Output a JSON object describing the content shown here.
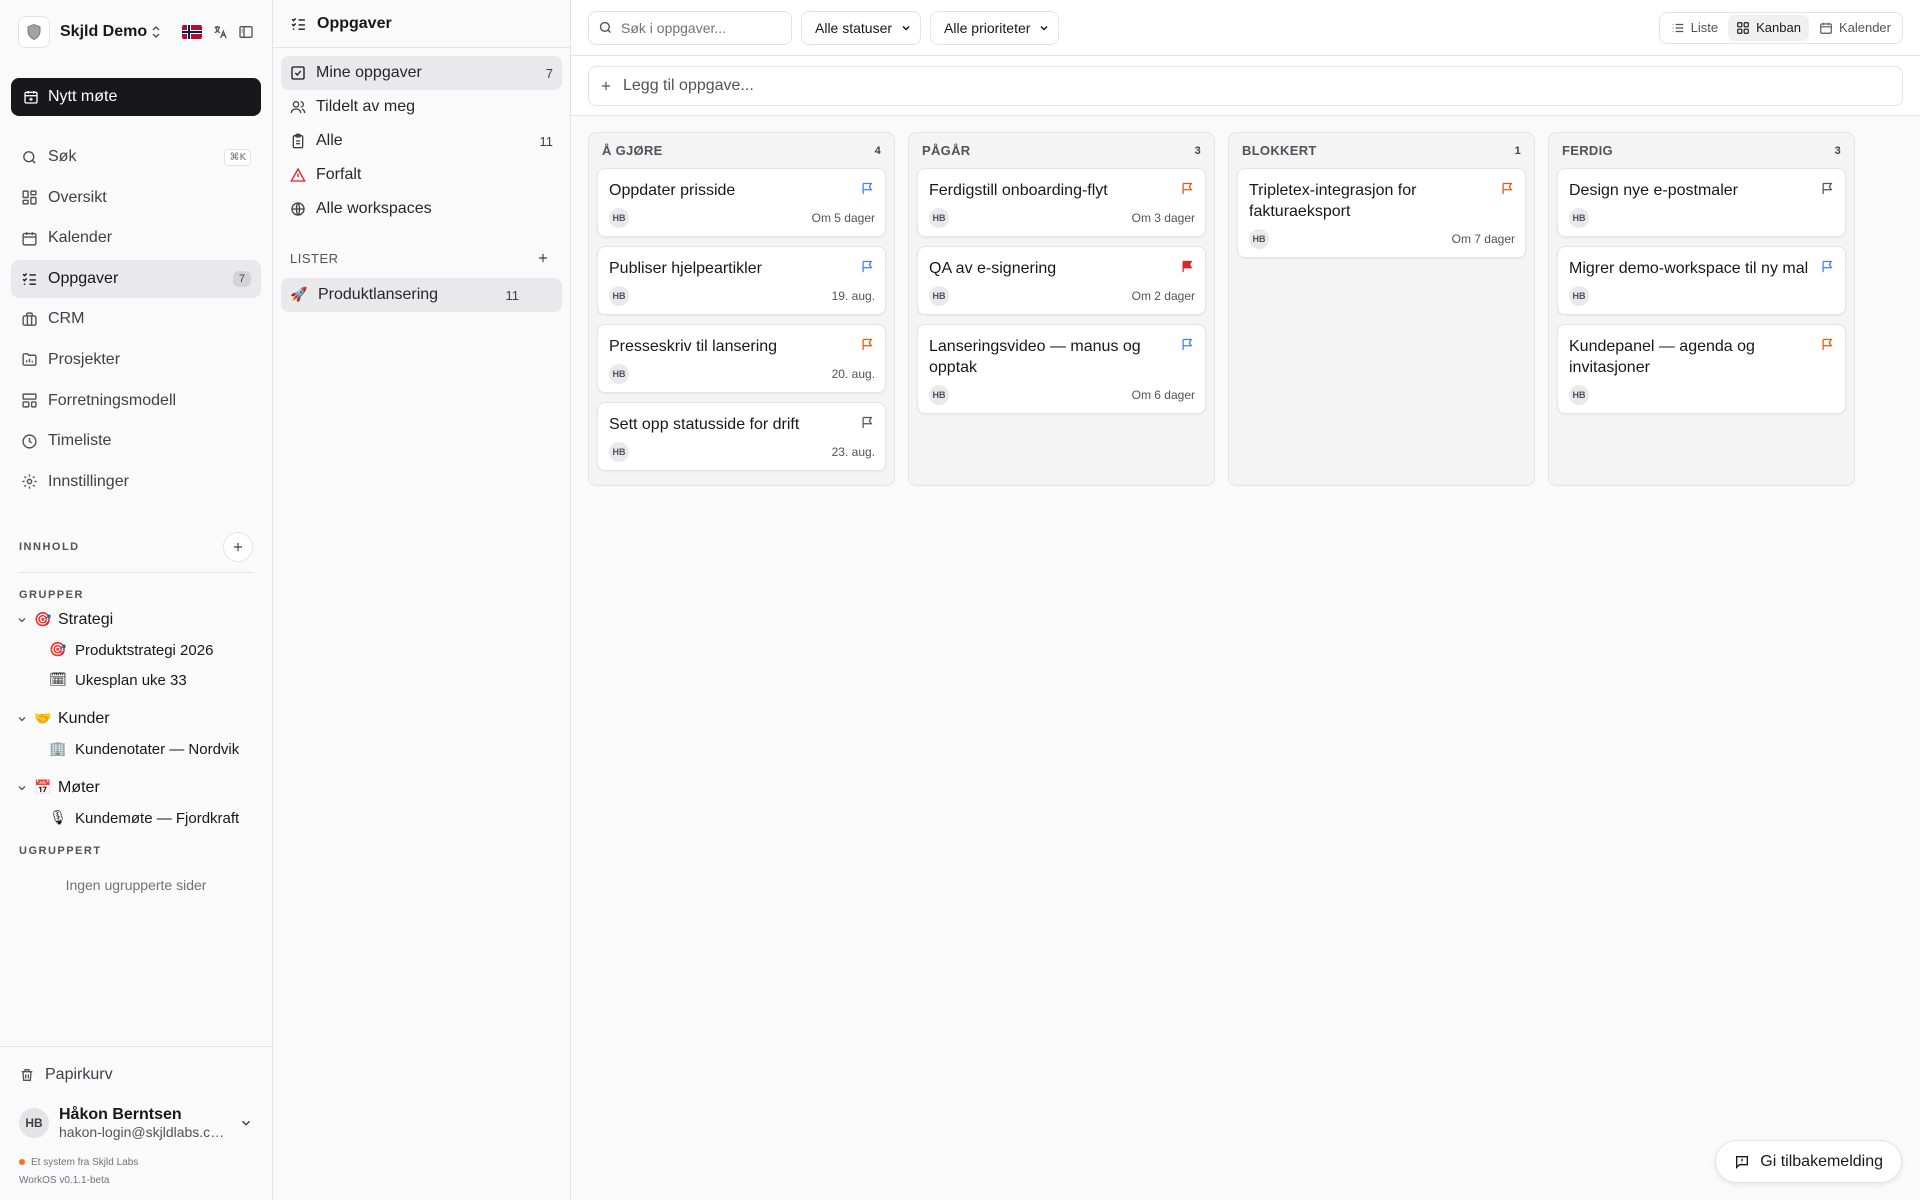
{
  "sidebar": {
    "workspace_name": "Skjld Demo",
    "new_meeting_label": "Nytt møte",
    "nav": [
      {
        "label": "Søk",
        "icon": "search-icon",
        "shortcut": "⌘K"
      },
      {
        "label": "Oversikt",
        "icon": "dashboard-icon"
      },
      {
        "label": "Kalender",
        "icon": "calendar-icon"
      },
      {
        "label": "Oppgaver",
        "icon": "tasks-icon",
        "badge": "7",
        "active": true
      },
      {
        "label": "CRM",
        "icon": "briefcase-icon"
      },
      {
        "label": "Prosjekter",
        "icon": "folder-chart-icon"
      },
      {
        "label": "Forretningsmodell",
        "icon": "layout-icon"
      },
      {
        "label": "Timeliste",
        "icon": "clock-icon"
      },
      {
        "label": "Innstillinger",
        "icon": "gear-icon"
      }
    ],
    "content_label": "INNHOLD",
    "groups_label": "GRUPPER",
    "groups": [
      {
        "emoji": "🎯",
        "label": "Strategi",
        "pages": [
          {
            "emoji": "🎯",
            "label": "Produktstrategi 2026"
          },
          {
            "emoji": "🗓",
            "label": "Ukesplan uke 33"
          }
        ]
      },
      {
        "emoji": "🤝",
        "label": "Kunder",
        "pages": [
          {
            "emoji": "🏢",
            "label": "Kundenotater — Nordvik"
          }
        ]
      },
      {
        "emoji": "📅",
        "label": "Møter",
        "pages": [
          {
            "emoji": "🎙",
            "label": "Kundemøte — Fjordkraft"
          }
        ]
      }
    ],
    "ungrouped_label": "UGRUPPERT",
    "ungrouped_empty": "Ingen ugrupperte sider",
    "trash_label": "Papirkurv",
    "user": {
      "initials": "HB",
      "name": "Håkon Berntsen",
      "email": "hakon-login@skjldlabs.com"
    },
    "credit": "Et system fra Skjld Labs",
    "version": "WorkOS v0.1.1-beta"
  },
  "panel": {
    "title": "Oppgaver",
    "items": [
      {
        "label": "Mine oppgaver",
        "count": "7",
        "icon": "checkbox-icon",
        "active": true
      },
      {
        "label": "Tildelt av meg",
        "count": "",
        "icon": "users-icon"
      },
      {
        "label": "Alle",
        "count": "11",
        "icon": "clipboard-icon"
      },
      {
        "label": "Forfalt",
        "count": "",
        "icon": "warning-icon"
      },
      {
        "label": "Alle workspaces",
        "count": "",
        "icon": "globe-icon"
      }
    ],
    "lists_label": "LISTER",
    "lists": [
      {
        "emoji": "🚀",
        "label": "Produktlansering",
        "count": "11"
      }
    ]
  },
  "toolbar": {
    "search_placeholder": "Søk i oppgaver...",
    "status_filter": "Alle statuser",
    "priority_filter": "Alle prioriteter",
    "views": [
      {
        "label": "Liste",
        "icon": "list-icon"
      },
      {
        "label": "Kanban",
        "icon": "kanban-icon",
        "active": true
      },
      {
        "label": "Kalender",
        "icon": "calendar-icon"
      }
    ]
  },
  "add_task_placeholder": "Legg til oppgave...",
  "colors": {
    "flag_blue": "#3b82f6",
    "flag_orange": "#ea580c",
    "flag_red": "#dc2626",
    "flag_gray": "#52525b"
  },
  "board": {
    "columns": [
      {
        "title": "Å GJØRE",
        "count": "4",
        "cards": [
          {
            "title": "Oppdater prisside",
            "assignee": "HB",
            "date": "Om 5 dager",
            "flag": "blue"
          },
          {
            "title": "Publiser hjelpeartikler",
            "assignee": "HB",
            "date": "19. aug.",
            "flag": "blue"
          },
          {
            "title": "Presseskriv til lansering",
            "assignee": "HB",
            "date": "20. aug.",
            "flag": "orange"
          },
          {
            "title": "Sett opp statusside for drift",
            "assignee": "HB",
            "date": "23. aug.",
            "flag": "gray"
          }
        ]
      },
      {
        "title": "PÅGÅR",
        "count": "3",
        "cards": [
          {
            "title": "Ferdigstill onboarding-flyt",
            "assignee": "HB",
            "date": "Om 3 dager",
            "flag": "orange"
          },
          {
            "title": "QA av e-signering",
            "assignee": "HB",
            "date": "Om 2 dager",
            "flag": "red-filled"
          },
          {
            "title": "Lanseringsvideo — manus og opptak",
            "assignee": "HB",
            "date": "Om 6 dager",
            "flag": "blue"
          }
        ]
      },
      {
        "title": "BLOKKERT",
        "count": "1",
        "cards": [
          {
            "title": "Tripletex-integrasjon for fakturaeksport",
            "assignee": "HB",
            "date": "Om 7 dager",
            "flag": "orange"
          }
        ]
      },
      {
        "title": "FERDIG",
        "count": "3",
        "cards": [
          {
            "title": "Design nye e-postmaler",
            "assignee": "HB",
            "date": "",
            "flag": "gray"
          },
          {
            "title": "Migrer demo-workspace til ny mal",
            "assignee": "HB",
            "date": "",
            "flag": "blue"
          },
          {
            "title": "Kundepanel — agenda og invitasjoner",
            "assignee": "HB",
            "date": "",
            "flag": "orange"
          }
        ]
      }
    ]
  },
  "feedback_label": "Gi tilbakemelding"
}
